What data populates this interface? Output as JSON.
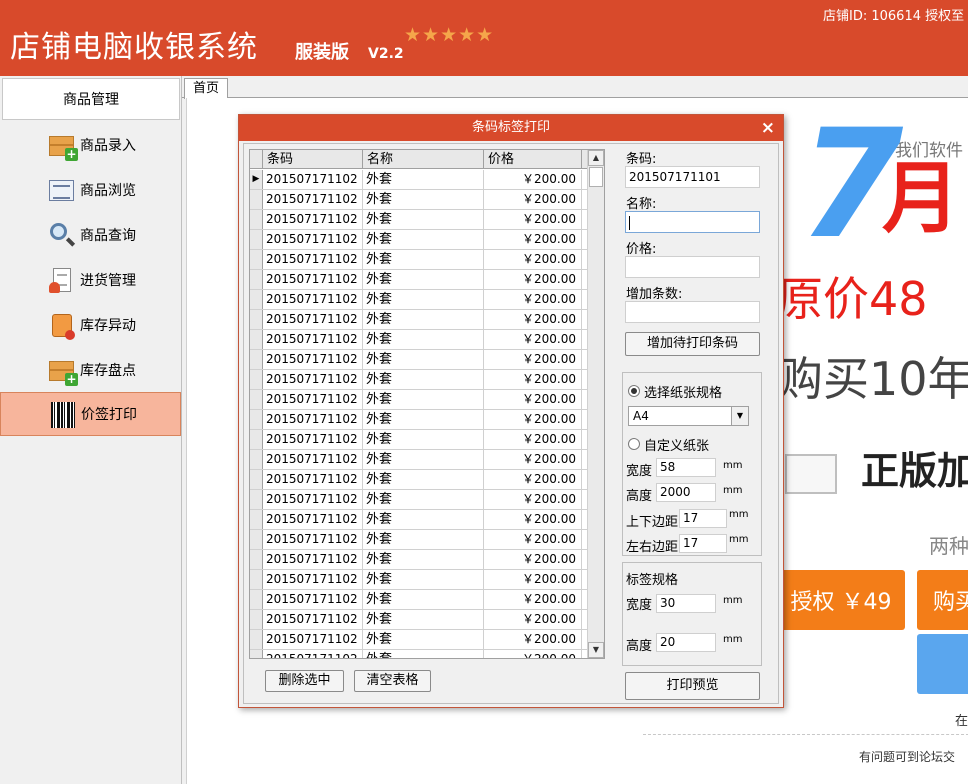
{
  "app": {
    "title": "店铺电脑收银系统",
    "edition": "服装版",
    "version": "V2.2",
    "stars": "★★★★★",
    "store_info": "店铺ID: 106614 授权至"
  },
  "sidebar": {
    "header": "商品管理",
    "items": [
      {
        "label": "商品录入",
        "icon": "box-add-icon"
      },
      {
        "label": "商品浏览",
        "icon": "list-icon"
      },
      {
        "label": "商品查询",
        "icon": "magnifier-icon"
      },
      {
        "label": "进货管理",
        "icon": "document-person-icon"
      },
      {
        "label": "库存异动",
        "icon": "bag-icon"
      },
      {
        "label": "库存盘点",
        "icon": "box-add-icon"
      },
      {
        "label": "价签打印",
        "icon": "barcode-icon",
        "active": true
      }
    ]
  },
  "tabs": [
    {
      "label": "首页"
    }
  ],
  "ad": {
    "tagline": "我们软件",
    "big_number": "7",
    "month": "月",
    "original_price": "原价48",
    "buy": "购买10年",
    "genuine": "正版加",
    "two": "两种",
    "auth_button": "授权 ￥49",
    "buy_button": "购买",
    "zai": "在",
    "forum": "有问题可到论坛交"
  },
  "dialog": {
    "title": "条码标签打印",
    "close": "×",
    "grid": {
      "columns": [
        "条码",
        "名称",
        "价格"
      ],
      "rows": [
        [
          "201507171102",
          "外套",
          "￥200.00"
        ],
        [
          "201507171102",
          "外套",
          "￥200.00"
        ],
        [
          "201507171102",
          "外套",
          "￥200.00"
        ],
        [
          "201507171102",
          "外套",
          "￥200.00"
        ],
        [
          "201507171102",
          "外套",
          "￥200.00"
        ],
        [
          "201507171102",
          "外套",
          "￥200.00"
        ],
        [
          "201507171102",
          "外套",
          "￥200.00"
        ],
        [
          "201507171102",
          "外套",
          "￥200.00"
        ],
        [
          "201507171102",
          "外套",
          "￥200.00"
        ],
        [
          "201507171102",
          "外套",
          "￥200.00"
        ],
        [
          "201507171102",
          "外套",
          "￥200.00"
        ],
        [
          "201507171102",
          "外套",
          "￥200.00"
        ],
        [
          "201507171102",
          "外套",
          "￥200.00"
        ],
        [
          "201507171102",
          "外套",
          "￥200.00"
        ],
        [
          "201507171102",
          "外套",
          "￥200.00"
        ],
        [
          "201507171102",
          "外套",
          "￥200.00"
        ],
        [
          "201507171102",
          "外套",
          "￥200.00"
        ],
        [
          "201507171102",
          "外套",
          "￥200.00"
        ],
        [
          "201507171102",
          "外套",
          "￥200.00"
        ],
        [
          "201507171102",
          "外套",
          "￥200.00"
        ],
        [
          "201507171102",
          "外套",
          "￥200.00"
        ],
        [
          "201507171102",
          "外套",
          "￥200.00"
        ],
        [
          "201507171102",
          "外套",
          "￥200.00"
        ],
        [
          "201507171102",
          "外套",
          "￥200.00"
        ],
        [
          "201507171102",
          "外套",
          "￥200.00"
        ]
      ],
      "current_row_marker": "▶"
    },
    "delete_button": "删除选中",
    "clear_button": "清空表格",
    "code_label": "条码:",
    "code_value": "201507171101",
    "name_label": "名称:",
    "name_value": "",
    "price_label": "价格:",
    "price_value": "",
    "count_label": "增加条数:",
    "count_value": "",
    "add_button": "增加待打印条码",
    "paper": {
      "select_label": "选择纸张规格",
      "selected": "A4",
      "custom_label": "自定义纸张",
      "width_label": "宽度",
      "width_value": "58",
      "height_label": "高度",
      "height_value": "2000",
      "vmargin_label": "上下边距",
      "vmargin_value": "17",
      "hmargin_label": "左右边距",
      "hmargin_value": "17",
      "unit": "mm"
    },
    "label_spec": {
      "title": "标签规格",
      "width_label": "宽度",
      "width_value": "30",
      "height_label": "高度",
      "height_value": "20",
      "unit": "mm"
    },
    "preview_button": "打印预览"
  }
}
